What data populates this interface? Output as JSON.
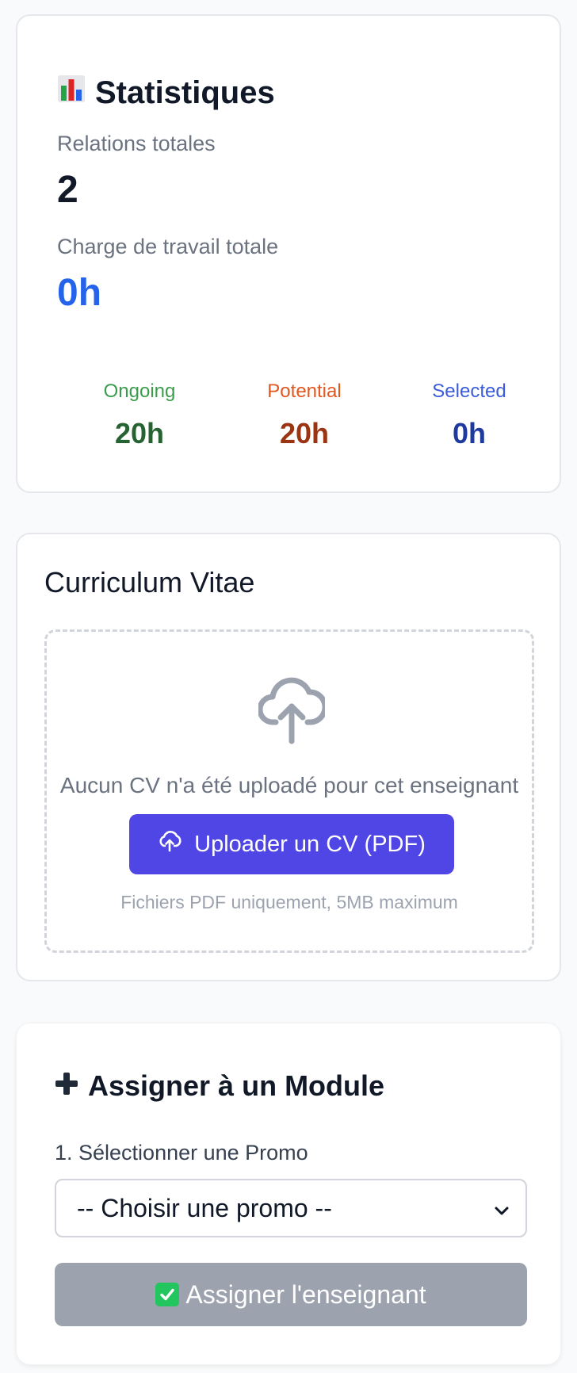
{
  "statistics": {
    "title": "Statistiques",
    "icon": "bar-chart-icon",
    "total_relations_label": "Relations totales",
    "total_relations_value": "2",
    "total_workload_label": "Charge de travail totale",
    "total_workload_value": "0h",
    "breakdown": [
      {
        "label": "Ongoing",
        "value": "20h",
        "label_color": "#3a9d4c",
        "value_color": "#276332"
      },
      {
        "label": "Potential",
        "value": "20h",
        "label_color": "#e2561f",
        "value_color": "#9a3412"
      },
      {
        "label": "Selected",
        "value": "0h",
        "label_color": "#3b5bdb",
        "value_color": "#1e3a9e"
      }
    ]
  },
  "cv": {
    "title": "Curriculum Vitae",
    "empty_message": "Aucun CV n'a été uploadé pour cet enseignant",
    "upload_button_label": "Uploader un CV (PDF)",
    "hint": "Fichiers PDF uniquement, 5MB maximum",
    "icon": "cloud-upload-icon"
  },
  "assign": {
    "title": "Assigner à un Module",
    "icon": "plus-icon",
    "promo_label": "1. Sélectionner une Promo",
    "promo_selected": "-- Choisir une promo --",
    "submit_label": "Assigner l'enseignant",
    "submit_icon": "check-mark-icon"
  },
  "colors": {
    "accent": "#4f46e5",
    "workload_blue": "#2563eb",
    "disabled": "#9ca3af"
  }
}
